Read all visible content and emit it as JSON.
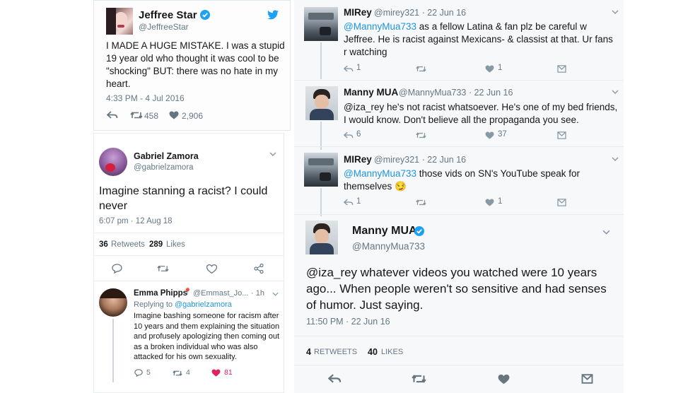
{
  "jeffree": {
    "name": "Jeffree Star",
    "handle": "@JeffreeStar",
    "text": "I MADE A HUGE MISTAKE. I was a stupid 19 year old who thought it was cool to be \"shocking\" BUT: there was no hate in my heart.",
    "time": "4:33 PM - 4 Jul 2016",
    "retweets": "458",
    "likes": "2,906",
    "icons": [
      "verified-badge-icon",
      "twitter-bird-icon",
      "reply-icon",
      "retweet-icon",
      "heart-icon"
    ]
  },
  "gabriel": {
    "name": "Gabriel Zamora",
    "handle": "@gabrielzamora",
    "text": "Imagine stanning a racist? I could never",
    "time": "6:07 pm · 12 Aug 18",
    "retweets_count": "36",
    "retweets_label": "Retweets",
    "likes_count": "289",
    "likes_label": "Likes",
    "icons": [
      "chevron-down-icon",
      "comment-icon",
      "retweet-icon",
      "heart-icon",
      "share-icon"
    ]
  },
  "emma": {
    "name": "Emma Phipps",
    "pin": "📍",
    "handle": "@Emmast_Jo...",
    "time": "· 1h",
    "replying_prefix": "Replying to",
    "replying_to": "@gabrielzamora",
    "text": "Imagine bashing someone for racism after 10 years and them explaining the situation and profusely apologizing then coming out as a broken individual who was also attacked for his own sexuality.",
    "replies": "5",
    "retweets": "4",
    "likes": "81",
    "like_color": "#e0245e"
  },
  "thread": {
    "t1": {
      "name": "MIRey",
      "handle": "@mirey321 · 22 Jun 16",
      "mention": "@MannyMua733",
      "text": " as a fellow Latina & fan plz be careful w Jeffree. He is racist against Mexicans- & classist at that. Ur fans r watching",
      "replies": "1",
      "likes": "1"
    },
    "t2": {
      "name": "Manny MUA",
      "handle": "@MannyMua733 · 22 Jun 16",
      "text": "@iza_rey he's not racist whatsoever. He's one of my bed friends, I would know. Don't believe all the propaganda you see.",
      "replies": "6",
      "likes": "37"
    },
    "t3": {
      "name": "MIRey",
      "handle": "@mirey321 · 22 Jun 16",
      "mention": "@MannyMua733",
      "text": " those vids on SN's YouTube speak for themselves 😏",
      "replies": "1",
      "likes": "1"
    },
    "t4": {
      "name": "Manny MUA",
      "handle": "@MannyMua733",
      "text": "@iza_rey whatever videos you watched were 10 years ago... When people weren't so sensitive and had senses of humor. Just saying.",
      "time": "11:50 PM · 22 Jun 16",
      "retweets_count": "4",
      "retweets_label": "RETWEETS",
      "likes_count": "40",
      "likes_label": "LIKES"
    },
    "verified_color": "#1da1f2"
  }
}
